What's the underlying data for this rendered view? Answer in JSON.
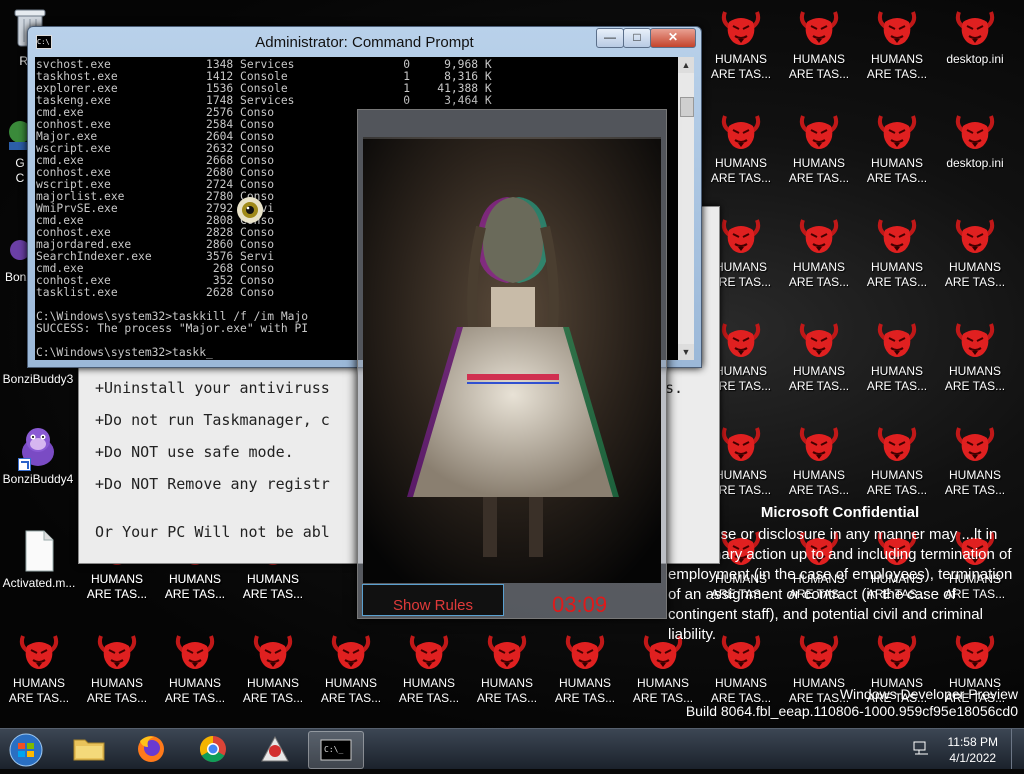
{
  "desktop": {
    "icons": [
      {
        "label": "Rec"
      },
      {
        "label": "G\nC"
      },
      {
        "label": "Bonzi"
      },
      {
        "label": "BonziBuddy3"
      },
      {
        "label": "BonziBuddy4"
      },
      {
        "label": "Activated.m..."
      },
      {
        "label": "HUMANS\nARE TAS..."
      },
      {
        "label": "desktop.ini"
      }
    ],
    "watermark": {
      "title": "Microsoft Confidential",
      "body": "...ized use or disclosure in any manner may ...lt in disciplinary action up to and including termination of employment (in the case of employees), termination of an assignment or contract (in the case of contingent staff), and potential civil and criminal liability."
    },
    "build": {
      "line1": "Windows Developer Preview",
      "line2": "Build 8064.fbl_eeap.110806-1000.959cf95e18056cd0"
    }
  },
  "rules_window": {
    "lines": [
      "+Uninstall your antiviruss",
      "+Do not run Taskmanager, c",
      "+Do NOT use safe mode.",
      "+Do NOT Remove any registr",
      "Or Your PC Will not be abl"
    ],
    "tail": "s."
  },
  "cmd": {
    "title": "Administrator: Command Prompt",
    "buttons": {
      "minimize": "—",
      "maximize": "□",
      "close": "✕"
    },
    "processes": [
      {
        "name": "svchost.exe",
        "pid": "1348",
        "session": "Services",
        "num": "0",
        "mem": "9,968 K"
      },
      {
        "name": "taskhost.exe",
        "pid": "1412",
        "session": "Console",
        "num": "1",
        "mem": "8,316 K"
      },
      {
        "name": "explorer.exe",
        "pid": "1536",
        "session": "Console",
        "num": "1",
        "mem": "41,388 K"
      },
      {
        "name": "taskeng.exe",
        "pid": "1748",
        "session": "Services",
        "num": "0",
        "mem": "3,464 K"
      },
      {
        "name": "cmd.exe",
        "pid": "2576",
        "session": "Conso",
        "num": "",
        "mem": ""
      },
      {
        "name": "conhost.exe",
        "pid": "2584",
        "session": "Conso",
        "num": "",
        "mem": ""
      },
      {
        "name": "Major.exe",
        "pid": "2604",
        "session": "Conso",
        "num": "",
        "mem": ""
      },
      {
        "name": "wscript.exe",
        "pid": "2632",
        "session": "Conso",
        "num": "",
        "mem": ""
      },
      {
        "name": "cmd.exe",
        "pid": "2668",
        "session": "Conso",
        "num": "",
        "mem": ""
      },
      {
        "name": "conhost.exe",
        "pid": "2680",
        "session": "Conso",
        "num": "",
        "mem": ""
      },
      {
        "name": "wscript.exe",
        "pid": "2724",
        "session": "Conso",
        "num": "",
        "mem": ""
      },
      {
        "name": "majorlist.exe",
        "pid": "2780",
        "session": "Conso",
        "num": "",
        "mem": ""
      },
      {
        "name": "WmiPrvSE.exe",
        "pid": "2792",
        "session": "Servi",
        "num": "",
        "mem": ""
      },
      {
        "name": "cmd.exe",
        "pid": "2808",
        "session": "Conso",
        "num": "",
        "mem": ""
      },
      {
        "name": "conhost.exe",
        "pid": "2828",
        "session": "Conso",
        "num": "",
        "mem": ""
      },
      {
        "name": "majordared.exe",
        "pid": "2860",
        "session": "Conso",
        "num": "",
        "mem": ""
      },
      {
        "name": "SearchIndexer.exe",
        "pid": "3576",
        "session": "Servi",
        "num": "",
        "mem": ""
      },
      {
        "name": "cmd.exe",
        "pid": "268",
        "session": "Conso",
        "num": "",
        "mem": ""
      },
      {
        "name": "conhost.exe",
        "pid": "352",
        "session": "Conso",
        "num": "",
        "mem": ""
      },
      {
        "name": "tasklist.exe",
        "pid": "2628",
        "session": "Conso",
        "num": "",
        "mem": ""
      }
    ],
    "command1": "C:\\Windows\\system32>taskkill /f /im Majo",
    "result1": "SUCCESS: The process \"Major.exe\" with PI",
    "prompt": "C:\\Windows\\system32>taskk_"
  },
  "scare_window": {
    "show_rules": "Show Rules",
    "timer": "03:09"
  },
  "taskbar": {
    "apps": [
      "start-orb",
      "file-explorer",
      "firefox",
      "chrome",
      "java-app",
      "command-prompt"
    ],
    "time": "11:58 PM",
    "date": "4/1/2022"
  },
  "colors": {
    "devil_red": "#e02020",
    "timer_red": "#e01a1a",
    "taskbar_top": "#3c4654",
    "console_text": "#c8c8c8"
  }
}
